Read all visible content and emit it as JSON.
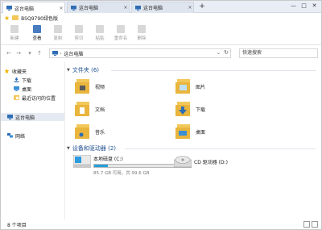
{
  "tabs": [
    {
      "label": "这台电脑",
      "close": "×",
      "active": true
    },
    {
      "label": "这台电脑",
      "close": "×",
      "active": false
    },
    {
      "label": "这台电脑",
      "close": "×",
      "active": false
    }
  ],
  "new_tab": "+",
  "window_controls": {
    "minimize": "—",
    "maximize": "□",
    "close": "✕"
  },
  "favorites_bar": {
    "item_label": "BSQ9790绿色版"
  },
  "toolbar": {
    "new_label": "新建",
    "view_label": "查看",
    "copy_label": "复制",
    "cut_label": "剪切",
    "paste_label": "粘贴",
    "rename_label": "重命名",
    "delete_label": "删除"
  },
  "nav": {
    "back": "←",
    "forward": "→",
    "up": "↑",
    "down": "▾"
  },
  "address": {
    "separator": "›",
    "location": "这台电脑",
    "dropdown": "⌄",
    "refresh": "↻"
  },
  "search": {
    "placeholder": "快速搜索"
  },
  "sidebar": {
    "favorites": "收藏夹",
    "downloads": "下载",
    "desktop": "桌面",
    "recent": "最近访问的位置",
    "this_pc": "这台电脑",
    "network": "网络"
  },
  "groups": {
    "folders_header": "文件夹 (6)",
    "drives_header": "设备和驱动器 (2)"
  },
  "folders": [
    {
      "label": "视频"
    },
    {
      "label": "图片"
    },
    {
      "label": "文档"
    },
    {
      "label": "下载"
    },
    {
      "label": "音乐"
    },
    {
      "label": "桌面"
    }
  ],
  "drives": [
    {
      "name": "本地磁盘 (C:)",
      "free_text": "85.7 GB 可用，共 99.6 GB",
      "used_fraction": 0.14
    },
    {
      "name": "CD 驱动器 (D:)"
    }
  ],
  "status": {
    "count": "8 个项目"
  },
  "colors": {
    "accent": "#1d4f91",
    "folder": "#f3c85a",
    "drive_bar": "#26a0da"
  }
}
